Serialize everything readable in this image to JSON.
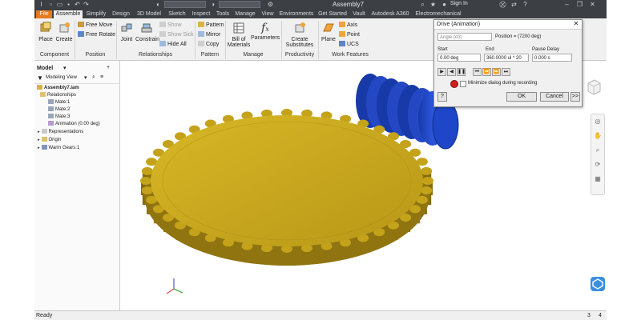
{
  "window": {
    "title": "Assembly7",
    "search_placeholder": "",
    "project_label": "",
    "sign_in": "Sign In"
  },
  "tabs": [
    {
      "label": "File"
    },
    {
      "label": "Assemble"
    },
    {
      "label": "Simplify"
    },
    {
      "label": "Design"
    },
    {
      "label": "3D Model"
    },
    {
      "label": "Sketch"
    },
    {
      "label": "Inspect"
    },
    {
      "label": "Tools"
    },
    {
      "label": "Manage"
    },
    {
      "label": "View"
    },
    {
      "label": "Environments"
    },
    {
      "label": "Get Started"
    },
    {
      "label": "Vault"
    },
    {
      "label": "Autodesk A360"
    },
    {
      "label": "Electromechanical"
    }
  ],
  "ribbon": {
    "component": {
      "label": "Component",
      "place": "Place",
      "create": "Create"
    },
    "position": {
      "label": "Position",
      "free_move": "Free Move",
      "free_rotate": "Free Rotate"
    },
    "relationships": {
      "label": "Relationships",
      "joint": "Joint",
      "constrain": "Constrain",
      "show": "Show",
      "show_sick": "Show Sick",
      "hide_all": "Hide All"
    },
    "pattern": {
      "label": "Pattern",
      "pattern": "Pattern",
      "mirror": "Mirror",
      "copy": "Copy"
    },
    "manage": {
      "label": "Manage",
      "bom_line1": "Bill of",
      "bom_line2": "Materials",
      "parameters": "Parameters"
    },
    "productivity": {
      "label": "Productivity",
      "create_line1": "Create",
      "create_line2": "Substitutes"
    },
    "work_features": {
      "label": "Work Features",
      "plane": "Plane",
      "axis": "Axis",
      "point": "Point",
      "ucs": "UCS"
    }
  },
  "browser": {
    "title": "Model",
    "view_label": "Modeling View",
    "tree": [
      {
        "label": "Assembly7.iam",
        "level": 0
      },
      {
        "label": "Relationships",
        "level": 1
      },
      {
        "label": "Mate:1",
        "level": 2
      },
      {
        "label": "Mate:2",
        "level": 2
      },
      {
        "label": "Mate:3",
        "level": 2
      },
      {
        "label": "Animation (0.00 deg)",
        "level": 2
      },
      {
        "label": "Representations",
        "level": 1
      },
      {
        "label": "Origin",
        "level": 1
      },
      {
        "label": "Warm Gears:1",
        "level": 1
      }
    ]
  },
  "dialog": {
    "title": "Drive (Animation)",
    "parameter": "Angle (d3)",
    "position": "Position = (7200 deg)",
    "start_label": "Start",
    "end_label": "End",
    "pause_label": "Pause Delay",
    "start_value": "0.00 deg",
    "end_value": "360.0000 ul * 20",
    "pause_value": "0.000 s",
    "minimize_label": "Minimize dialog during recording",
    "ok": "OK",
    "cancel": "Cancel",
    "more": ">>"
  },
  "status": {
    "text": "Ready",
    "num1": "3",
    "num2": "4"
  },
  "colors": {
    "gear": "#c9a81c",
    "gear_dark": "#8f7410",
    "worm": "#1f45c8",
    "accent": "#e8791d"
  }
}
